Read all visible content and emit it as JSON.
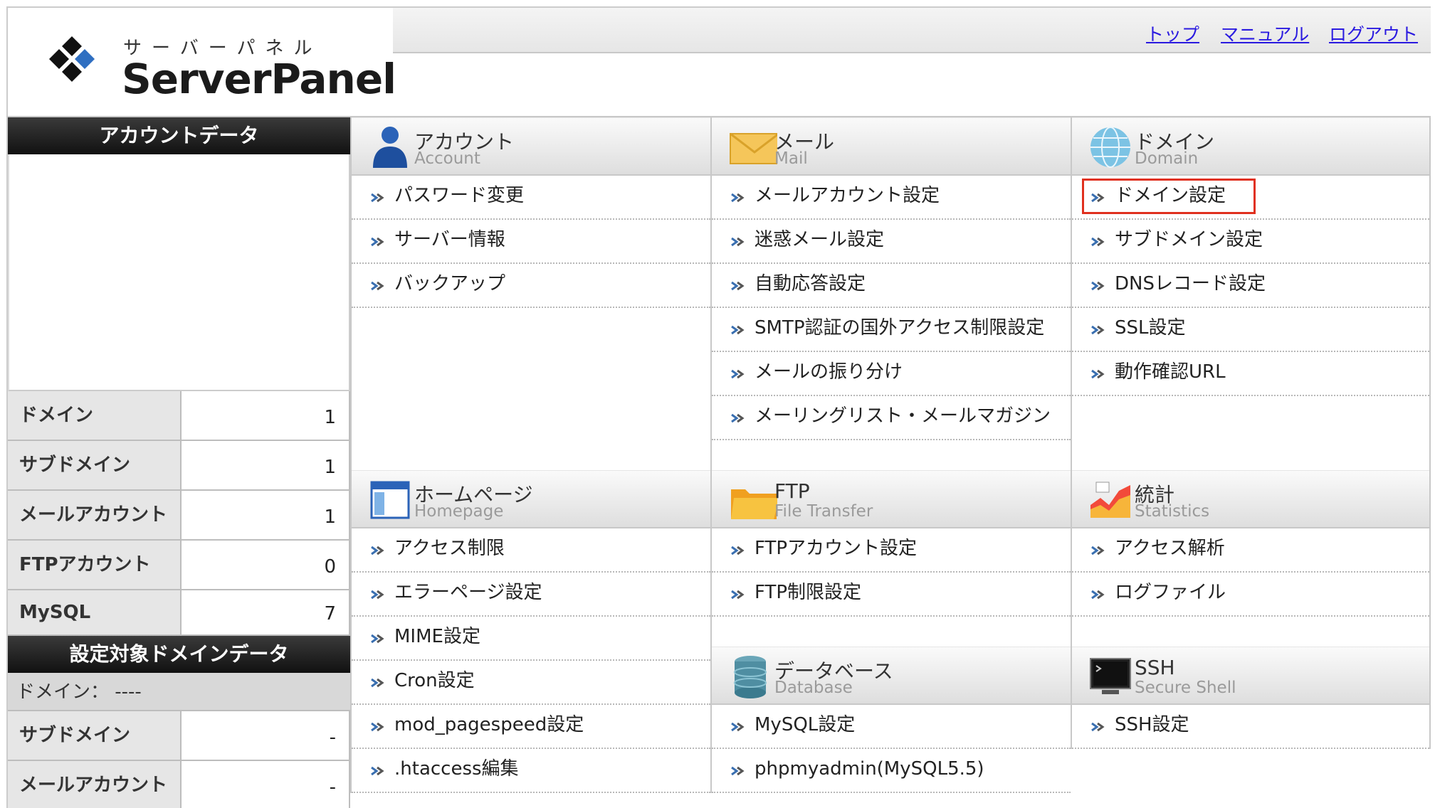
{
  "logo": {
    "kana": "サーバーパネル",
    "name": "ServerPanel"
  },
  "topnav": [
    {
      "label": "トップ"
    },
    {
      "label": "マニュアル"
    },
    {
      "label": "ログアウト"
    }
  ],
  "sidebar": {
    "account_title": "アカウントデータ",
    "account_rows": [
      {
        "label": "ドメイン",
        "value": "1"
      },
      {
        "label": "サブドメイン",
        "value": "1"
      },
      {
        "label": "メールアカウント",
        "value": "1"
      },
      {
        "label": "FTPアカウント",
        "value": "0"
      },
      {
        "label": "MySQL",
        "value": "7"
      }
    ],
    "domain_title": "設定対象ドメインデータ",
    "domain_line": "ドメイン： ----",
    "domain_rows": [
      {
        "label": "サブドメイン",
        "value": "-"
      },
      {
        "label": "メールアカウント",
        "value": "-"
      }
    ]
  },
  "sections": {
    "account": {
      "jp": "アカウント",
      "en": "Account",
      "icon": "user-icon",
      "items": [
        "パスワード変更",
        "サーバー情報",
        "バックアップ"
      ]
    },
    "mail": {
      "jp": "メール",
      "en": "Mail",
      "icon": "envelope-icon",
      "items": [
        "メールアカウント設定",
        "迷惑メール設定",
        "自動応答設定",
        "SMTP認証の国外アクセス制限設定",
        "メールの振り分け",
        "メーリングリスト・メールマガジン"
      ]
    },
    "domain": {
      "jp": "ドメイン",
      "en": "Domain",
      "icon": "globe-icon",
      "items": [
        "ドメイン設定",
        "サブドメイン設定",
        "DNSレコード設定",
        "SSL設定",
        "動作確認URL"
      ]
    },
    "homepage": {
      "jp": "ホームページ",
      "en": "Homepage",
      "icon": "browser-window-icon",
      "items": [
        "アクセス制限",
        "エラーページ設定",
        "MIME設定",
        "Cron設定",
        "mod_pagespeed設定",
        ".htaccess編集"
      ]
    },
    "ftp": {
      "jp": "FTP",
      "en": "File Transfer",
      "icon": "folder-icon",
      "items": [
        "FTPアカウント設定",
        "FTP制限設定"
      ]
    },
    "stats": {
      "jp": "統計",
      "en": "Statistics",
      "icon": "chart-icon",
      "items": [
        "アクセス解析",
        "ログファイル"
      ]
    },
    "database": {
      "jp": "データベース",
      "en": "Database",
      "icon": "database-icon",
      "items": [
        "MySQL設定",
        "phpmyadmin(MySQL5.5)"
      ]
    },
    "ssh": {
      "jp": "SSH",
      "en": "Secure Shell",
      "icon": "terminal-icon",
      "items": [
        "SSH設定"
      ]
    }
  },
  "colors": {
    "link": "#2a1ae0",
    "highlight": "#e0301e",
    "arrow": "#3a6fb0"
  }
}
